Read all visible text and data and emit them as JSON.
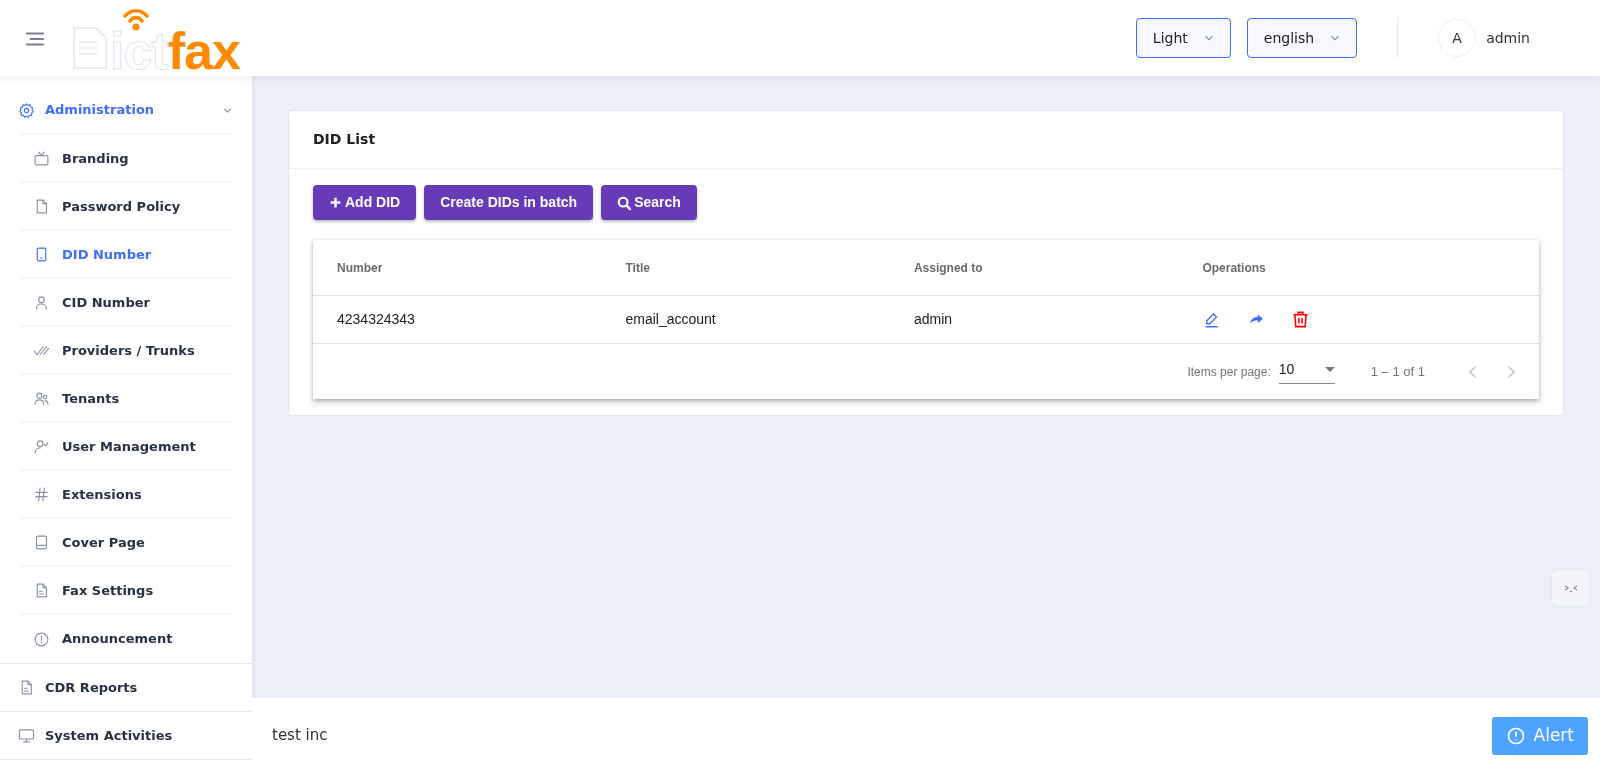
{
  "header": {
    "logo": {
      "part_1": "ict",
      "part_2": "fax"
    },
    "theme_select": {
      "value": "Light"
    },
    "language_select": {
      "value": "english"
    },
    "user": {
      "avatar_initial": "A",
      "name": "admin"
    }
  },
  "sidebar": {
    "items": [
      {
        "label": "Administration",
        "expanded": true,
        "children": [
          {
            "label": "Branding",
            "selected": false
          },
          {
            "label": "Password Policy",
            "selected": false
          },
          {
            "label": "DID Number",
            "selected": true
          },
          {
            "label": "CID Number",
            "selected": false
          },
          {
            "label": "Providers / Trunks",
            "selected": false
          },
          {
            "label": "Tenants",
            "selected": false
          },
          {
            "label": "User Management",
            "selected": false
          },
          {
            "label": "Extensions",
            "selected": false
          },
          {
            "label": "Cover Page",
            "selected": false
          },
          {
            "label": "Fax Settings",
            "selected": false
          },
          {
            "label": "Announcement",
            "selected": false
          }
        ]
      },
      {
        "label": "CDR Reports",
        "expanded": false
      },
      {
        "label": "System Activities",
        "expanded": false
      }
    ]
  },
  "card": {
    "title": "DID List",
    "buttons": [
      {
        "label": "Add DID",
        "kind": "add"
      },
      {
        "label": "Create DIDs in batch",
        "kind": "plain"
      },
      {
        "label": "Search",
        "kind": "search"
      }
    ],
    "table": {
      "columns": [
        "Number",
        "Title",
        "Assigned to",
        "Operations"
      ],
      "rows": [
        {
          "cells": [
            "4234324343",
            "email_account",
            "admin"
          ]
        }
      ],
      "paginator": {
        "items_per_page_label": "Items per page:",
        "page_size": "10",
        "range": "1 – 1 of 1",
        "previous_page": {
          "disabled": true
        },
        "next_page": {
          "disabled": true
        }
      }
    }
  },
  "footer": {
    "company": "test inc",
    "alert_button": "Alert"
  }
}
